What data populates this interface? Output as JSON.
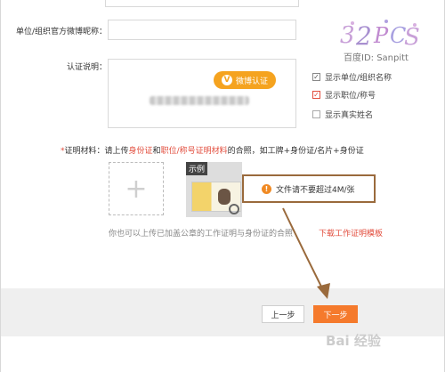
{
  "form": {
    "weibo_label": "单位/组织官方微博昵称：",
    "auth_label": "认证说明：",
    "weibo_auth_button": "微博认证",
    "options": [
      {
        "label": "显示单位/组织名称",
        "state": "checked"
      },
      {
        "label": "显示职位/称号",
        "state": "checked-red"
      },
      {
        "label": "显示真实姓名",
        "state": "unchecked"
      }
    ]
  },
  "proof": {
    "asterisk": "*",
    "title": "证明材料：",
    "text1": "请上传",
    "link1": "身份证",
    "text2": "和",
    "link2": "职位/称号证明材料",
    "text3": "的合照，如工牌+身份证/名片+身份证",
    "sample_tag": "示例",
    "warning": "文件请不要超过4M/张",
    "hint": "你也可以上传已加盖公章的工作证明与身份证的合照",
    "download_link": "下载工作证明模板"
  },
  "footer": {
    "prev_label": "上一步",
    "next_label": "下一步"
  },
  "watermark": {
    "logo_text": "百度ID: Sanpitt",
    "site": "Bai 经验"
  },
  "colors": {
    "accent_orange": "#f57a2c",
    "link_red": "#e24c3c",
    "highlight_brown": "#9a6a3c"
  }
}
